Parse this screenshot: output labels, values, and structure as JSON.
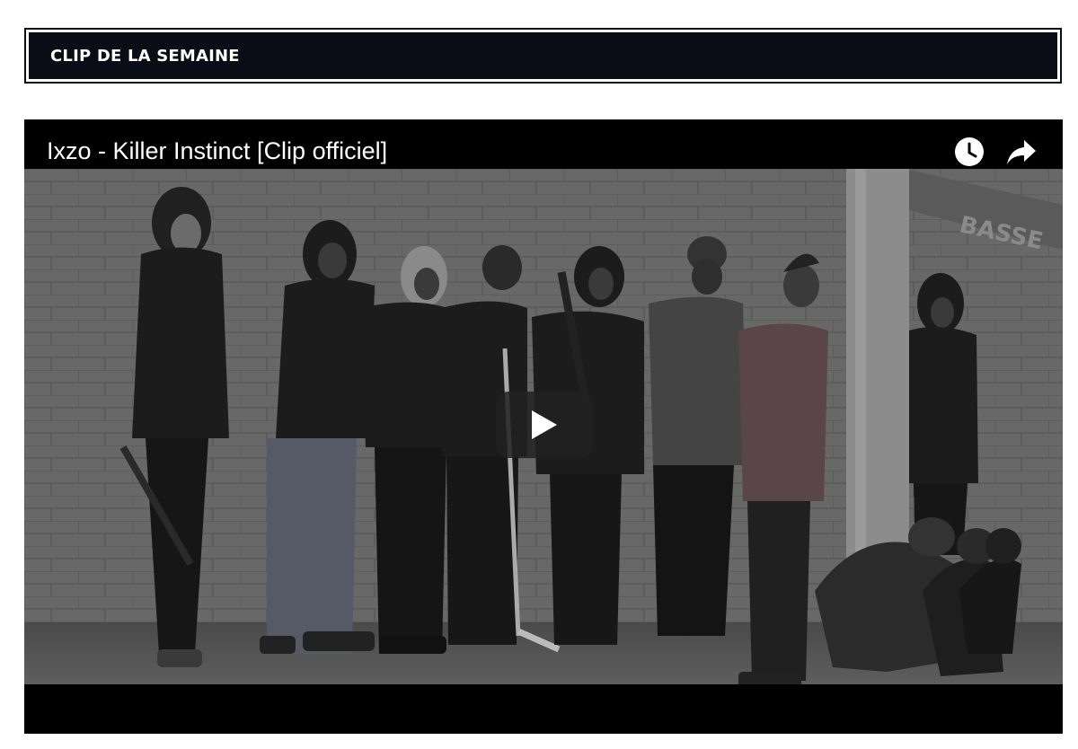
{
  "section": {
    "title": "CLIP DE LA SEMAINE"
  },
  "video": {
    "title": "Ixzo - Killer Instinct [Clip officiel]",
    "actions": [
      {
        "name": "watch-later",
        "icon": "clock-icon"
      },
      {
        "name": "share",
        "icon": "share-arrow-icon"
      }
    ],
    "play_icon": "play-icon",
    "wall_sign_text": "BASSE"
  },
  "colors": {
    "header_bg": "#0a0d15",
    "header_text": "#ffffff",
    "player_bg": "#000000",
    "play_button_bg": "#212121"
  }
}
